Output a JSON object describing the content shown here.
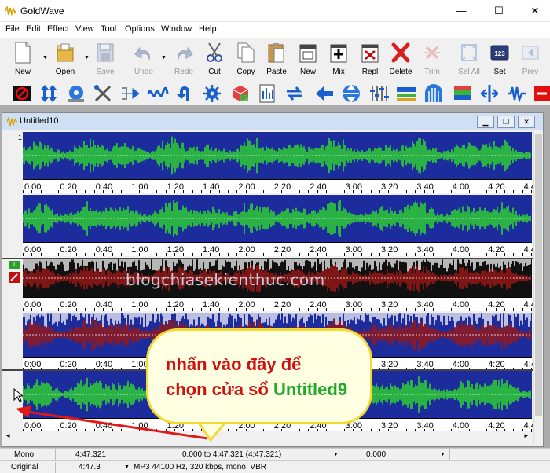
{
  "app": {
    "title": "GoldWave"
  },
  "window_controls": {
    "minimize": "—",
    "maximize": "☐",
    "close": "✕"
  },
  "menu": [
    "File",
    "Edit",
    "Effect",
    "View",
    "Tool",
    "Options",
    "Window",
    "Help"
  ],
  "toolbar": [
    {
      "label": "New",
      "icon": "new-file-icon",
      "enabled": true
    },
    {
      "label": "Open",
      "icon": "open-folder-icon",
      "enabled": true
    },
    {
      "label": "Save",
      "icon": "save-icon",
      "enabled": false
    },
    {
      "label": "Undo",
      "icon": "undo-icon",
      "enabled": false
    },
    {
      "label": "Redo",
      "icon": "redo-icon",
      "enabled": false
    },
    {
      "label": "Cut",
      "icon": "scissors-icon",
      "enabled": true
    },
    {
      "label": "Copy",
      "icon": "copy-icon",
      "enabled": true
    },
    {
      "label": "Paste",
      "icon": "paste-icon",
      "enabled": true
    },
    {
      "label": "New",
      "icon": "paste-new-icon",
      "enabled": true
    },
    {
      "label": "Mix",
      "icon": "mix-icon",
      "enabled": true
    },
    {
      "label": "Repl",
      "icon": "replace-icon",
      "enabled": true
    },
    {
      "label": "Delete",
      "icon": "delete-icon",
      "enabled": true
    },
    {
      "label": "Trim",
      "icon": "trim-icon",
      "enabled": false
    },
    {
      "label": "Sel All",
      "icon": "select-all-icon",
      "enabled": false
    },
    {
      "label": "Set",
      "icon": "set-icon",
      "enabled": true
    },
    {
      "label": "Prev",
      "icon": "previous-icon",
      "enabled": false
    }
  ],
  "document": {
    "title": "Untitled10",
    "channel_label": "1",
    "zero_label": "0",
    "time_ticks": [
      "0:00",
      "0:20",
      "0:40",
      "1:00",
      "1:20",
      "1:40",
      "2:00",
      "2:20",
      "2:40",
      "3:00",
      "3:20",
      "3:40",
      "4:00",
      "4:20",
      "4:4"
    ]
  },
  "watermark": "blogchiasekienthuc.com",
  "callout": {
    "line1": "nhấn vào đây để",
    "line2_prefix": "chọn cửa sổ ",
    "line2_highlight": "Untitled9"
  },
  "status_rows": [
    {
      "channels": "Mono",
      "length": "4:47.321",
      "selection": "0.000 to 4:47.321 (4:47.321)",
      "position": "0.000"
    },
    {
      "channels": "Original",
      "length": "4:47.3",
      "format": "MP3 44100 Hz, 320 kbps, mono, VBR"
    }
  ],
  "colors": {
    "wave_background": "#1c2c9c",
    "wave_green": "#2fd42f",
    "wave_red": "#9a1818",
    "wave_white": "#ffffff",
    "callout_border": "#f3da32",
    "callout_text": "#d01010",
    "callout_highlight": "#1faa2a",
    "arrow": "#e01818"
  }
}
